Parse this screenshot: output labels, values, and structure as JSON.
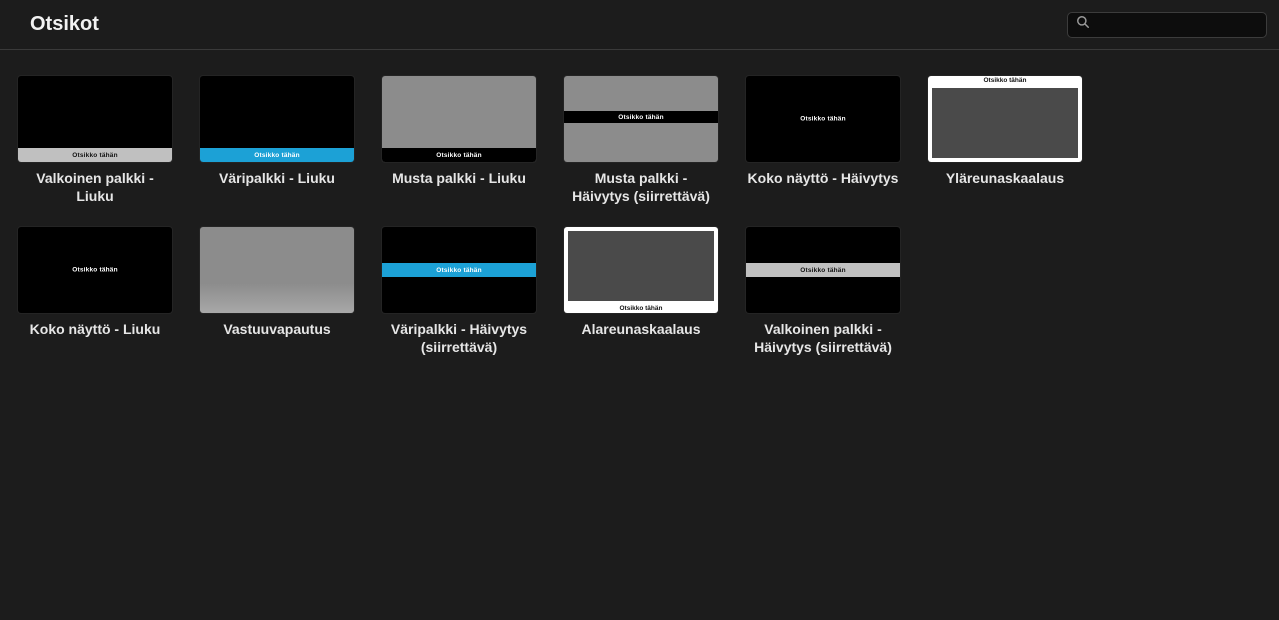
{
  "header": {
    "title": "Otsikot"
  },
  "search": {
    "placeholder": ""
  },
  "thumb_text": "Otsikko tähän",
  "tiles": [
    {
      "label": "Valkoinen palkki - Liuku"
    },
    {
      "label": "Väripalkki - Liuku"
    },
    {
      "label": "Musta palkki - Liuku"
    },
    {
      "label": "Musta palkki - Häivytys (siirrettävä)"
    },
    {
      "label": "Koko näyttö - Häivytys"
    },
    {
      "label": "Yläreunaskaalaus"
    },
    {
      "label": "Koko näyttö - Liuku"
    },
    {
      "label": "Vastuuvapautus"
    },
    {
      "label": "Väripalkki - Häivytys (siirrettävä)"
    },
    {
      "label": "Alareunaskaalaus"
    },
    {
      "label": "Valkoinen palkki - Häivytys (siirrettävä)"
    }
  ]
}
